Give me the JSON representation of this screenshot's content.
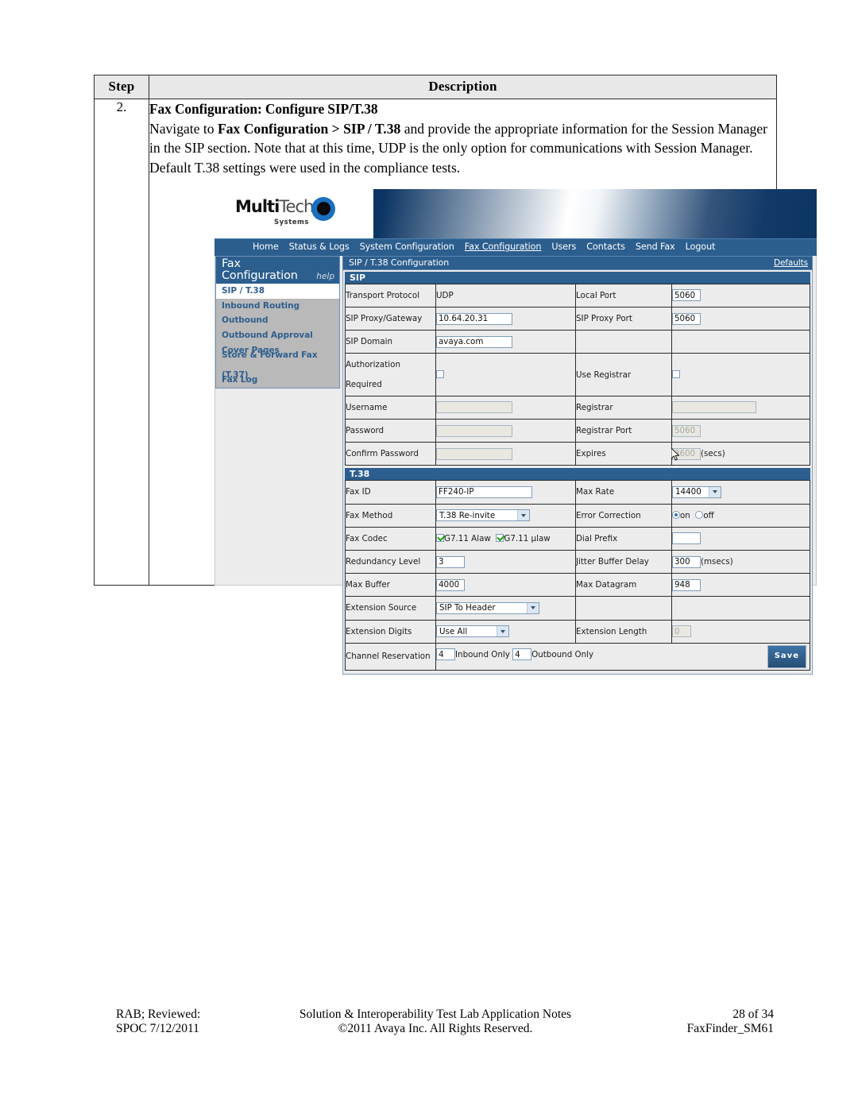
{
  "table": {
    "headers": {
      "step": "Step",
      "description": "Description"
    },
    "row": {
      "step": "2.",
      "title": "Fax Configuration: Configure SIP/T.38",
      "body_pre": "Navigate to ",
      "body_b1": "Fax Configuration > SIP / T.38",
      "body_post": " and provide the appropriate information for the Session Manager in the SIP section. Note that at this time, UDP is the only option for communications with Session Manager.  Default T.38 settings were used in the compliance tests."
    }
  },
  "app": {
    "logo": {
      "multi": "Multi",
      "tech": "Tech",
      "tm": "’",
      "systems": "Systems"
    },
    "nav": [
      {
        "label": "Home",
        "active": false
      },
      {
        "label": "Status & Logs",
        "active": false
      },
      {
        "label": "System Configuration",
        "active": false
      },
      {
        "label": "Fax Configuration",
        "active": true
      },
      {
        "label": "Users",
        "active": false
      },
      {
        "label": "Contacts",
        "active": false
      },
      {
        "label": "Send Fax",
        "active": false
      },
      {
        "label": "Logout",
        "active": false
      }
    ],
    "sidebar": {
      "title_line1": "Fax",
      "title_line2": "Configuration",
      "help": "help",
      "items": [
        {
          "label": "SIP / T.38",
          "selected": true
        },
        {
          "label": "Inbound Routing",
          "selected": false
        },
        {
          "label": "Outbound",
          "selected": false
        },
        {
          "label": "Outbound Approval",
          "selected": false
        },
        {
          "label": "Cover Pages",
          "selected": false
        },
        {
          "label": "Store & Forward Fax (T.37)",
          "selected": false
        },
        {
          "label": "Fax Log",
          "selected": false
        }
      ]
    },
    "panel": {
      "title": "SIP / T.38 Configuration",
      "defaults_link": "Defaults"
    },
    "sip": {
      "section_title": "SIP",
      "transport_protocol_label": "Transport Protocol",
      "transport_protocol_value": "UDP",
      "local_port_label": "Local Port",
      "local_port_value": "5060",
      "sip_proxy_label": "SIP Proxy/Gateway",
      "sip_proxy_value": "10.64.20.31",
      "sip_proxy_port_label": "SIP Proxy Port",
      "sip_proxy_port_value": "5060",
      "sip_domain_label": "SIP Domain",
      "sip_domain_value": "avaya.com",
      "auth_required_label": "Authorization Required",
      "auth_required_checked": false,
      "use_registrar_label": "Use Registrar",
      "use_registrar_checked": false,
      "username_label": "Username",
      "username_value": "",
      "registrar_label": "Registrar",
      "registrar_value": "",
      "password_label": "Password",
      "password_value": "",
      "registrar_port_label": "Registrar Port",
      "registrar_port_value": "5060",
      "confirm_password_label": "Confirm Password",
      "confirm_password_value": "",
      "expires_label": "Expires",
      "expires_value": "3600",
      "expires_units": "(secs)"
    },
    "t38": {
      "section_title": "T.38",
      "fax_id_label": "Fax ID",
      "fax_id_value": "FF240-IP",
      "max_rate_label": "Max Rate",
      "max_rate_value": "14400",
      "fax_method_label": "Fax Method",
      "fax_method_value": "T.38 Re-invite",
      "error_correction_label": "Error Correction",
      "error_correction_on": "on",
      "error_correction_off": "off",
      "error_correction_value": "on",
      "fax_codec_label": "Fax Codec",
      "codec_alaw_label": "G7.11 Alaw",
      "codec_alaw_checked": true,
      "codec_ulaw_label": "G7.11 µlaw",
      "codec_ulaw_checked": true,
      "dial_prefix_label": "Dial Prefix",
      "dial_prefix_value": "",
      "redundancy_label": "Redundancy Level",
      "redundancy_value": "3",
      "jitter_label": "Jitter Buffer Delay",
      "jitter_value": "300",
      "jitter_units": "(msecs)",
      "max_buffer_label": "Max Buffer",
      "max_buffer_value": "4000",
      "max_datagram_label": "Max Datagram",
      "max_datagram_value": "948",
      "ext_source_label": "Extension Source",
      "ext_source_value": "SIP To Header",
      "ext_digits_label": "Extension Digits",
      "ext_digits_value": "Use All",
      "ext_length_label": "Extension Length",
      "ext_length_value": "0",
      "channel_res_label": "Channel Reservation",
      "channel_inbound_value": "4",
      "channel_inbound_label": "Inbound Only",
      "channel_outbound_value": "4",
      "channel_outbound_label": "Outbound Only",
      "save_label": "Save"
    },
    "colors": {
      "banner": "#0C3563",
      "nav": "#2C5E8E",
      "panel_bg": "#ECECEC",
      "sidebar_items": "#B9B9B9",
      "link": "#2F5F8F"
    }
  },
  "footer": {
    "left_line1": "RAB; Reviewed:",
    "left_line2": "SPOC 7/12/2011",
    "center_line1": "Solution & Interoperability Test Lab Application Notes",
    "center_line2": "©2011 Avaya Inc. All Rights Reserved.",
    "right_line1": "28 of 34",
    "right_line2": "FaxFinder_SM61"
  }
}
